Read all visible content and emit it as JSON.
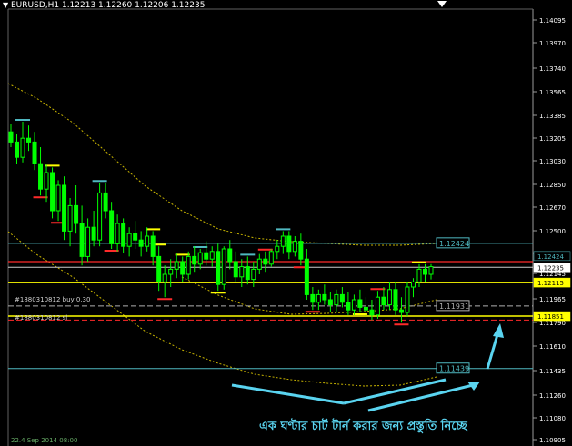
{
  "window": {
    "title": "EURUSD,H1  1.12213 1.12260 1.12206 1.12235"
  },
  "colors": {
    "background": "#000000",
    "candles": "#00ff00",
    "bollinger": "#c8b400",
    "support": "#ffff00",
    "resistance": "#ff2a2a",
    "level_cyan": "#4fb8c0",
    "highlight_yellow": "#ffff00",
    "price_current": "#ffffff",
    "annotation": "#5ad4f0"
  },
  "price_axis": {
    "labels": [
      "1.14095",
      "1.13970",
      "1.13740",
      "1.13565",
      "1.13385",
      "1.13205",
      "1.13030",
      "1.12850",
      "1.12670",
      "1.12500",
      "1.12320",
      "1.12145",
      "1.11965",
      "1.11790",
      "1.11610",
      "1.11435",
      "1.11260",
      "1.11080",
      "1.10905"
    ],
    "current_price": "1.12235",
    "level_cyan_top": "1.12424",
    "level_yellow": "1.12115",
    "level_dash": "1.11931",
    "level_highlight": "1.11851",
    "level_cyan_bottom": "1.11439"
  },
  "orders": {
    "buy_label": "#1880310812 buy 0.30",
    "sl_label": "#1880310812 sl"
  },
  "annotation": {
    "text": "এক ঘণ্টার চার্ট টার্ন করার জন্য প্রস্তুতি নিচ্ছে"
  },
  "time_axis": {
    "label": "22.4 Sep 2014 08:00"
  },
  "chart_data": {
    "type": "candlestick",
    "symbol": "EURUSD",
    "timeframe": "H1",
    "ylim": [
      1.1088,
      1.1418
    ],
    "candles": [
      [
        1.133,
        1.1336,
        1.1318,
        1.1322
      ],
      [
        1.1322,
        1.1328,
        1.1305,
        1.131
      ],
      [
        1.131,
        1.1338,
        1.1306,
        1.1325
      ],
      [
        1.1325,
        1.1335,
        1.1315,
        1.1322
      ],
      [
        1.1322,
        1.133,
        1.13,
        1.1305
      ],
      [
        1.1305,
        1.1318,
        1.128,
        1.1285
      ],
      [
        1.1285,
        1.1305,
        1.1275,
        1.1298
      ],
      [
        1.1298,
        1.1302,
        1.1262,
        1.1268
      ],
      [
        1.1268,
        1.1292,
        1.126,
        1.1288
      ],
      [
        1.1288,
        1.1295,
        1.1245,
        1.1252
      ],
      [
        1.1252,
        1.1278,
        1.124,
        1.1272
      ],
      [
        1.1272,
        1.1288,
        1.125,
        1.1258
      ],
      [
        1.1258,
        1.1272,
        1.1225,
        1.1232
      ],
      [
        1.1232,
        1.1262,
        1.1228,
        1.1255
      ],
      [
        1.1255,
        1.1268,
        1.124,
        1.1245
      ],
      [
        1.1245,
        1.129,
        1.124,
        1.1282
      ],
      [
        1.1282,
        1.129,
        1.1262,
        1.1268
      ],
      [
        1.1268,
        1.1275,
        1.1238,
        1.1242
      ],
      [
        1.1242,
        1.1265,
        1.1236,
        1.1258
      ],
      [
        1.1258,
        1.1262,
        1.1235,
        1.124
      ],
      [
        1.124,
        1.1255,
        1.1232,
        1.125
      ],
      [
        1.125,
        1.126,
        1.1238,
        1.1245
      ],
      [
        1.1245,
        1.1252,
        1.1232,
        1.124
      ],
      [
        1.124,
        1.1255,
        1.1236,
        1.1248
      ],
      [
        1.1248,
        1.1252,
        1.1225,
        1.1232
      ],
      [
        1.1232,
        1.124,
        1.1205,
        1.1212
      ],
      [
        1.1212,
        1.1225,
        1.12,
        1.1218
      ],
      [
        1.1218,
        1.123,
        1.1208,
        1.1222
      ],
      [
        1.1222,
        1.1235,
        1.1215,
        1.1228
      ],
      [
        1.1228,
        1.1232,
        1.1212,
        1.1218
      ],
      [
        1.1218,
        1.1236,
        1.1214,
        1.1232
      ],
      [
        1.1232,
        1.124,
        1.122,
        1.1226
      ],
      [
        1.1226,
        1.1238,
        1.1222,
        1.1235
      ],
      [
        1.1235,
        1.1244,
        1.1225,
        1.123
      ],
      [
        1.123,
        1.124,
        1.1224,
        1.1236
      ],
      [
        1.1236,
        1.1242,
        1.1205,
        1.121
      ],
      [
        1.121,
        1.124,
        1.1206,
        1.1238
      ],
      [
        1.1238,
        1.1245,
        1.1222,
        1.1228
      ],
      [
        1.1228,
        1.1236,
        1.1212,
        1.1216
      ],
      [
        1.1216,
        1.123,
        1.1208,
        1.1224
      ],
      [
        1.1224,
        1.1232,
        1.121,
        1.1214
      ],
      [
        1.1214,
        1.1228,
        1.1208,
        1.1222
      ],
      [
        1.1222,
        1.1234,
        1.1218,
        1.123
      ],
      [
        1.123,
        1.1236,
        1.122,
        1.1226
      ],
      [
        1.1226,
        1.1238,
        1.1224,
        1.1236
      ],
      [
        1.1236,
        1.1245,
        1.123,
        1.124
      ],
      [
        1.124,
        1.1252,
        1.1234,
        1.1248
      ],
      [
        1.1248,
        1.1252,
        1.123,
        1.1236
      ],
      [
        1.1236,
        1.1248,
        1.1232,
        1.1244
      ],
      [
        1.1244,
        1.125,
        1.1225,
        1.123
      ],
      [
        1.123,
        1.1238,
        1.1198,
        1.1202
      ],
      [
        1.1202,
        1.1208,
        1.119,
        1.1196
      ],
      [
        1.1196,
        1.1206,
        1.119,
        1.1202
      ],
      [
        1.1202,
        1.121,
        1.1194,
        1.1198
      ],
      [
        1.1198,
        1.1204,
        1.1188,
        1.1194
      ],
      [
        1.1194,
        1.1206,
        1.1188,
        1.1202
      ],
      [
        1.1202,
        1.1208,
        1.1192,
        1.1196
      ],
      [
        1.1196,
        1.1204,
        1.1186,
        1.119
      ],
      [
        1.119,
        1.1202,
        1.1186,
        1.1198
      ],
      [
        1.1198,
        1.1206,
        1.1188,
        1.1192
      ],
      [
        1.1192,
        1.12,
        1.1184,
        1.119
      ],
      [
        1.119,
        1.1198,
        1.1182,
        1.1186
      ],
      [
        1.1186,
        1.1205,
        1.1183,
        1.12
      ],
      [
        1.12,
        1.1208,
        1.119,
        1.1194
      ],
      [
        1.1194,
        1.1212,
        1.119,
        1.1206
      ],
      [
        1.1206,
        1.1212,
        1.1186,
        1.119
      ],
      [
        1.119,
        1.12,
        1.118,
        1.1188
      ],
      [
        1.1188,
        1.1212,
        1.1185,
        1.1208
      ],
      [
        1.1208,
        1.1215,
        1.12,
        1.1212
      ],
      [
        1.1212,
        1.1226,
        1.1208,
        1.1222
      ],
      [
        1.1222,
        1.1226,
        1.1212,
        1.1218
      ],
      [
        1.1218,
        1.1226,
        1.1214,
        1.1224
      ]
    ]
  }
}
